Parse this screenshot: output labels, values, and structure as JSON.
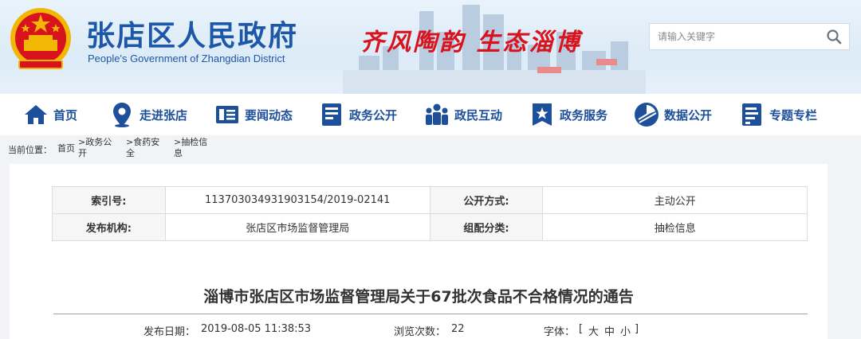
{
  "header": {
    "title": "张店区人民政府",
    "subtitle": "People's Government of Zhangdian District",
    "slogan": "齐风陶韵 生态淄博"
  },
  "search": {
    "placeholder": "请输入关键字"
  },
  "nav": {
    "items": [
      {
        "label": "首页",
        "icon": "home-icon"
      },
      {
        "label": "走进张店",
        "icon": "location-pin-icon"
      },
      {
        "label": "要闻动态",
        "icon": "news-icon"
      },
      {
        "label": "政务公开",
        "icon": "document-icon"
      },
      {
        "label": "政民互动",
        "icon": "people-icon"
      },
      {
        "label": "政务服务",
        "icon": "star-icon"
      },
      {
        "label": "数据公开",
        "icon": "pie-chart-icon"
      },
      {
        "label": "专题专栏",
        "icon": "topic-icon"
      }
    ]
  },
  "breadcrumb": {
    "prefix": "当前位置：",
    "items": [
      "首页",
      ">政务公开",
      ">食药安全",
      ">抽检信息"
    ]
  },
  "meta": {
    "rows": [
      {
        "k1": "索引号:",
        "v1": "113703034931903154/2019-02141",
        "k2": "公开方式:",
        "v2": "主动公开"
      },
      {
        "k1": "发布机构:",
        "v1": "张店区市场监督管理局",
        "k2": "组配分类:",
        "v2": "抽检信息"
      }
    ]
  },
  "article": {
    "title": "淄博市张店区市场监督管理局关于67批次食品不合格情况的通告",
    "publish_label": "发布日期：",
    "publish_date": "2019-08-05 11:38:53",
    "views_label": "浏览次数：",
    "views": "22",
    "font_label": "字体：",
    "font_open": "[",
    "font_large": "大",
    "font_medium": "中",
    "font_small": "小",
    "font_close": "]"
  },
  "colors": {
    "brand_blue": "#1d57a8",
    "nav_blue": "#1d4f9a",
    "slogan_red": "#d8131e"
  }
}
